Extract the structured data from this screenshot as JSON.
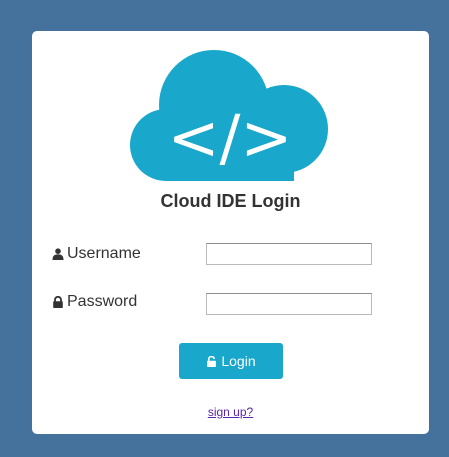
{
  "colors": {
    "page_background": "#44729c",
    "card_background": "#ffffff",
    "accent": "#19a7cc",
    "link": "#5a25a7"
  },
  "logo": {
    "icon": "cloud-code-icon",
    "glyph": "</>"
  },
  "title": "Cloud IDE Login",
  "username": {
    "icon": "user-icon",
    "label": "Username",
    "value": "",
    "placeholder": ""
  },
  "password": {
    "icon": "lock-icon",
    "label": "Password",
    "value": "",
    "placeholder": ""
  },
  "login_button": {
    "icon": "unlock-icon",
    "label": "Login"
  },
  "signup_link": "sign up?"
}
